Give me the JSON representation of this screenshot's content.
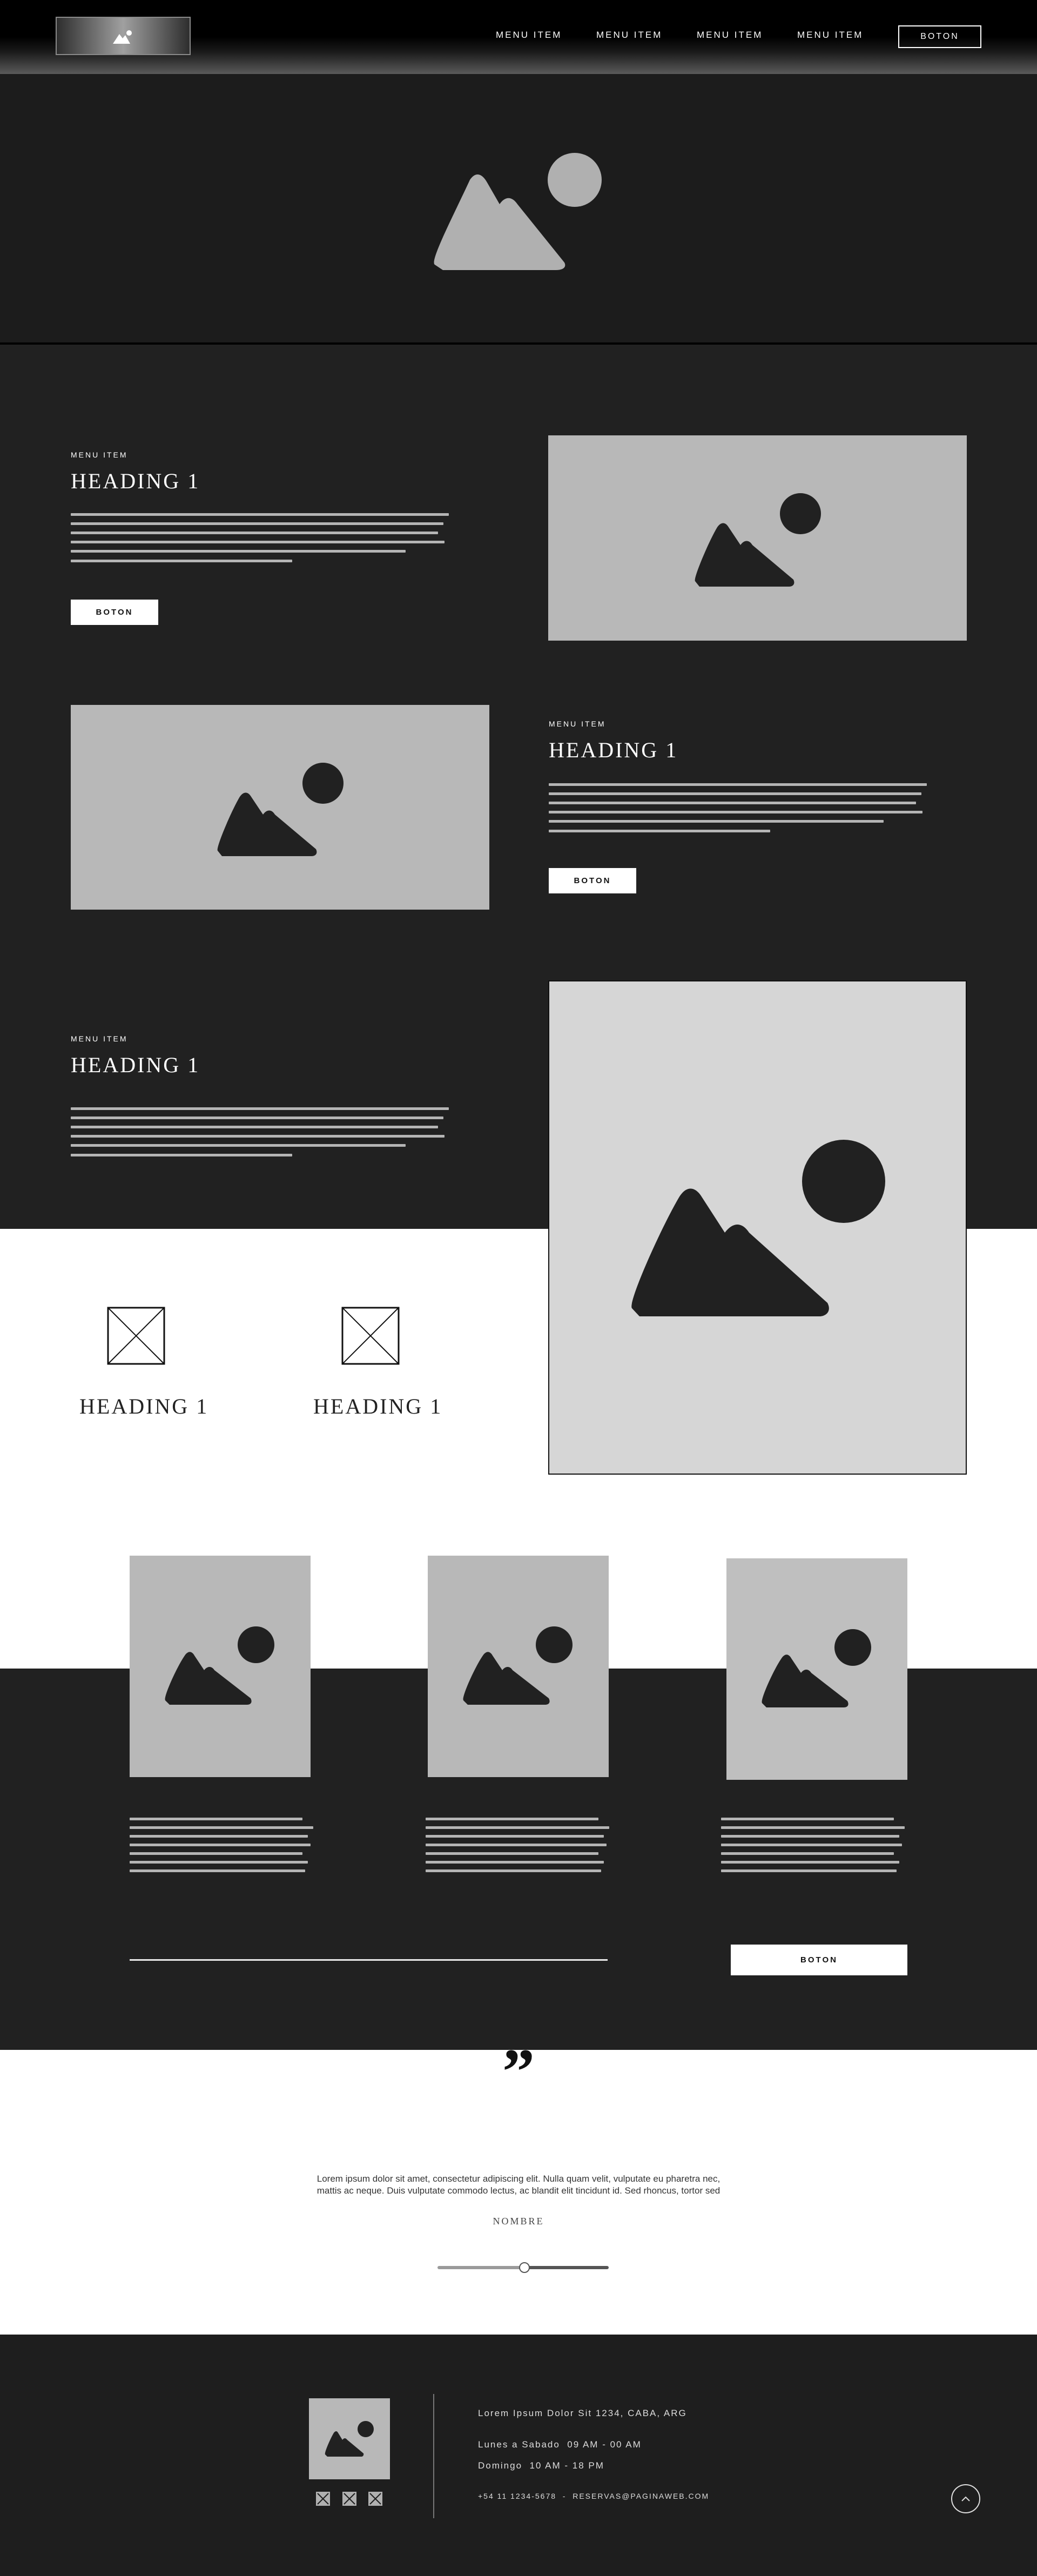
{
  "header": {
    "nav": [
      "MENU ITEM",
      "MENU ITEM",
      "MENU ITEM",
      "MENU ITEM"
    ],
    "button_label": "BOTON"
  },
  "section1": {
    "kicker": "MENU ITEM",
    "heading": "HEADING 1",
    "button_label": "BOTON"
  },
  "section2": {
    "kicker": "MENU ITEM",
    "heading": "HEADING 1",
    "button_label": "BOTON"
  },
  "section3": {
    "kicker": "MENU ITEM",
    "heading": "HEADING 1"
  },
  "features": [
    {
      "heading": "HEADING 1"
    },
    {
      "heading": "HEADING 1"
    }
  ],
  "cards_section": {
    "button_label": "BOTON"
  },
  "testimonial": {
    "quote_mark": "”",
    "line1": "Lorem ipsum dolor sit amet, consectetur adipiscing elit. Nulla quam velit, vulputate eu pharetra nec,",
    "line2": "mattis ac neque. Duis vulputate commodo lectus, ac blandit elit tincidunt id. Sed rhoncus, tortor sed",
    "name": "NOMBRE",
    "slider_level_percent": 50
  },
  "footer": {
    "address": "Lorem Ipsum Dolor Sit 1234, CABA, ARG",
    "hours1": "Lunes a Sabado  09 AM - 00 AM",
    "hours2": "Domingo  10 AM - 18 PM",
    "contact": "+54 11 1234-5678  -  RESERVAS@PAGINAWEB.COM",
    "social_icons": [
      "social-icon",
      "social-icon",
      "social-icon"
    ],
    "scroll_top_icon": "chevron-up-icon"
  },
  "colors": {
    "dark_bg": "#212121",
    "placeholder_gray": "#b8b8b8",
    "light_gray": "#d6d6d6",
    "white": "#ffffff"
  }
}
